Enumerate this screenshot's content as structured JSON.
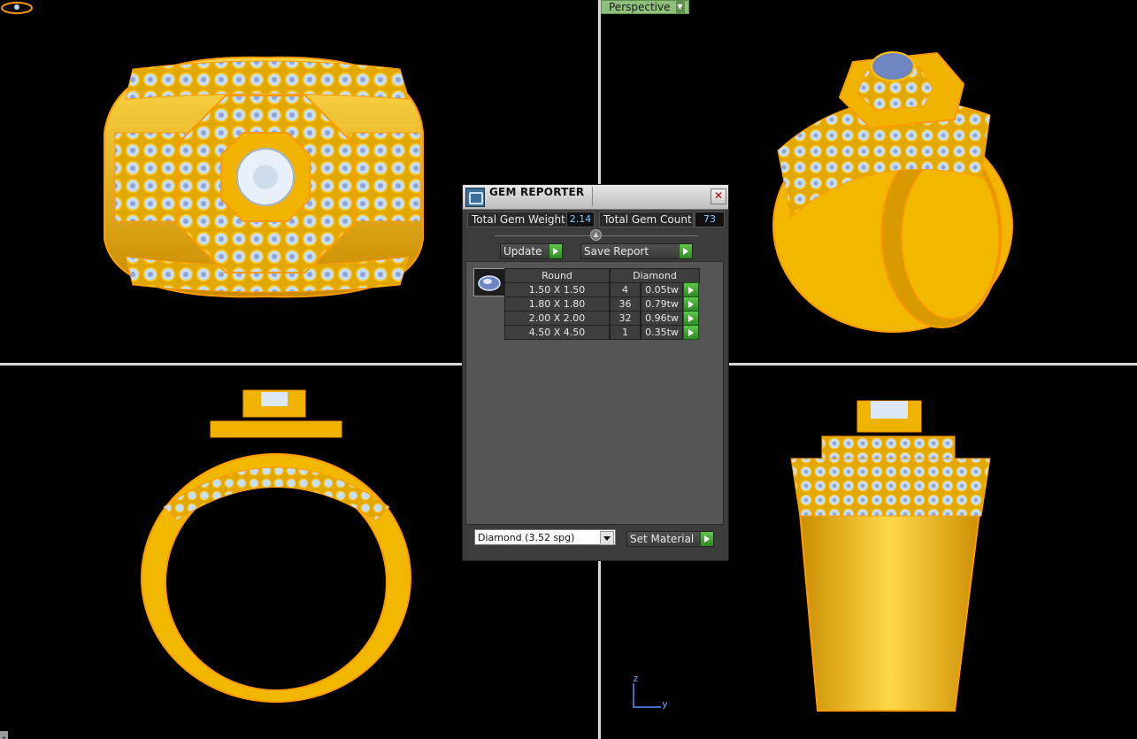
{
  "viewport": {
    "active_view_label": "Perspective",
    "axis_z": "z",
    "axis_y": "y"
  },
  "gem_reporter": {
    "title": "GEM REPORTER",
    "total_gem_weight_label": "Total Gem Weight",
    "total_gem_weight_value": "2.14",
    "total_gem_count_label": "Total Gem Count",
    "total_gem_count_value": "73",
    "update_label": "Update",
    "save_report_label": "Save Report",
    "table": {
      "shape_header": "Round",
      "material_header": "Diamond",
      "rows": [
        {
          "size": "1.50 X 1.50",
          "count": "4",
          "weight": "0.05tw"
        },
        {
          "size": "1.80 X 1.80",
          "count": "36",
          "weight": "0.79tw"
        },
        {
          "size": "2.00 X 2.00",
          "count": "32",
          "weight": "0.96tw"
        },
        {
          "size": "4.50 X 4.50",
          "count": "1",
          "weight": "0.35tw"
        }
      ]
    },
    "material_select": "Diamond    (3.52 spg)",
    "set_material_label": "Set Material"
  },
  "colors": {
    "gold": "#f2b800",
    "gold_edge": "#ff9a00",
    "gem": "#b7d3f2",
    "panel_bg": "#3c3c3c",
    "accent_value": "#7fc8ff",
    "go_button": "#3fa832"
  }
}
